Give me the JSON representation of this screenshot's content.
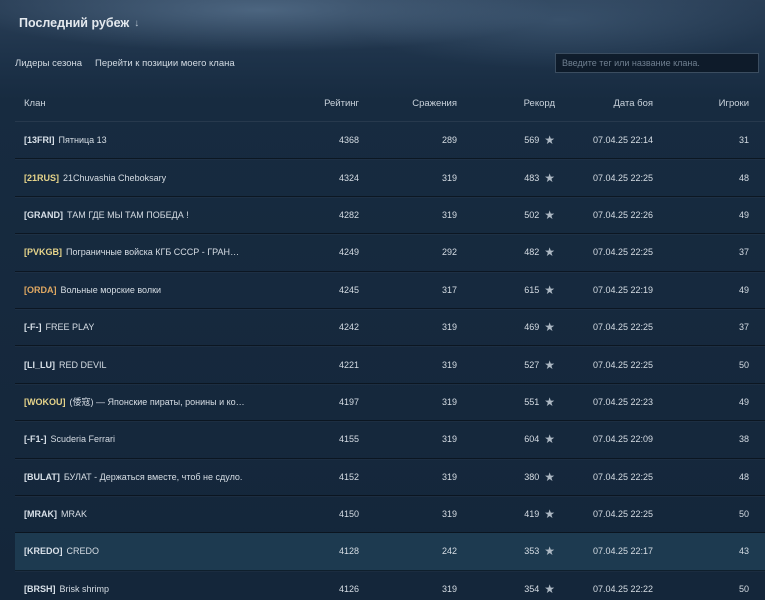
{
  "header": {
    "title": "Последний рубеж",
    "chevron": "↓"
  },
  "tabs": {
    "leaders": "Лидеры сезона",
    "my_clan": "Перейти к позиции моего клана"
  },
  "search": {
    "placeholder": "Введите тег или название клана."
  },
  "table": {
    "columns": {
      "clan": "Клан",
      "rating": "Рейтинг",
      "battles": "Сражения",
      "record": "Рекорд",
      "date": "Дата боя",
      "players": "Игроки"
    },
    "rows": [
      {
        "tag": "[13FRI]",
        "tag_color": "#d8e0e8",
        "name": "Пятница 13",
        "rating": "4368",
        "battles": "289",
        "record": "569",
        "date": "07.04.25 22:14",
        "players": "31",
        "highlighted": false
      },
      {
        "tag": "[21RUS]",
        "tag_color": "#e6d48a",
        "name": "21Chuvashia Cheboksary",
        "rating": "4324",
        "battles": "319",
        "record": "483",
        "date": "07.04.25 22:25",
        "players": "48",
        "highlighted": false
      },
      {
        "tag": "[GRAND]",
        "tag_color": "#d8e0e8",
        "name": "ТАМ ГДЕ МЫ ТАМ ПОБЕДА !",
        "rating": "4282",
        "battles": "319",
        "record": "502",
        "date": "07.04.25 22:26",
        "players": "49",
        "highlighted": false
      },
      {
        "tag": "[PVKGB]",
        "tag_color": "#e6d48a",
        "name": "Пограничные войска КГБ СССР - ГРАНИЦА НА ЗА...",
        "rating": "4249",
        "battles": "292",
        "record": "482",
        "date": "07.04.25 22:25",
        "players": "37",
        "highlighted": false
      },
      {
        "tag": "[ORDA]",
        "tag_color": "#e0a862",
        "name": "Вольные морские волки",
        "rating": "4245",
        "battles": "317",
        "record": "615",
        "date": "07.04.25 22:19",
        "players": "49",
        "highlighted": false
      },
      {
        "tag": "[-F-]",
        "tag_color": "#d8e0e8",
        "name": "FREE PLAY",
        "rating": "4242",
        "battles": "319",
        "record": "469",
        "date": "07.04.25 22:25",
        "players": "37",
        "highlighted": false
      },
      {
        "tag": "[LI_LU]",
        "tag_color": "#d8e0e8",
        "name": "RED DEVIL",
        "rating": "4221",
        "battles": "319",
        "record": "527",
        "date": "07.04.25 22:25",
        "players": "50",
        "highlighted": false
      },
      {
        "tag": "[WOKOU]",
        "tag_color": "#e6d48a",
        "name": "(倭寇) — Японские пираты, ронины и контрабанд...",
        "rating": "4197",
        "battles": "319",
        "record": "551",
        "date": "07.04.25 22:23",
        "players": "49",
        "highlighted": false
      },
      {
        "tag": "[-F1-]",
        "tag_color": "#d8e0e8",
        "name": "Scuderia Ferrari",
        "rating": "4155",
        "battles": "319",
        "record": "604",
        "date": "07.04.25 22:09",
        "players": "38",
        "highlighted": false
      },
      {
        "tag": "[BULAT]",
        "tag_color": "#d8e0e8",
        "name": "БУЛАТ - Держаться вместе, чтоб не сдуло.",
        "rating": "4152",
        "battles": "319",
        "record": "380",
        "date": "07.04.25 22:25",
        "players": "48",
        "highlighted": false
      },
      {
        "tag": "[MRAK]",
        "tag_color": "#d8e0e8",
        "name": "MRAK",
        "rating": "4150",
        "battles": "319",
        "record": "419",
        "date": "07.04.25 22:25",
        "players": "50",
        "highlighted": false
      },
      {
        "tag": "[KREDO]",
        "tag_color": "#d8e0e8",
        "name": "CREDO",
        "rating": "4128",
        "battles": "242",
        "record": "353",
        "date": "07.04.25 22:17",
        "players": "43",
        "highlighted": true
      },
      {
        "tag": "[BRSH]",
        "tag_color": "#d8e0e8",
        "name": "Brisk shrimp",
        "rating": "4126",
        "battles": "319",
        "record": "354",
        "date": "07.04.25 22:22",
        "players": "50",
        "highlighted": false
      }
    ]
  },
  "icons": {
    "record_star": "star-icon",
    "title_chevron": "chevron-down-icon"
  }
}
